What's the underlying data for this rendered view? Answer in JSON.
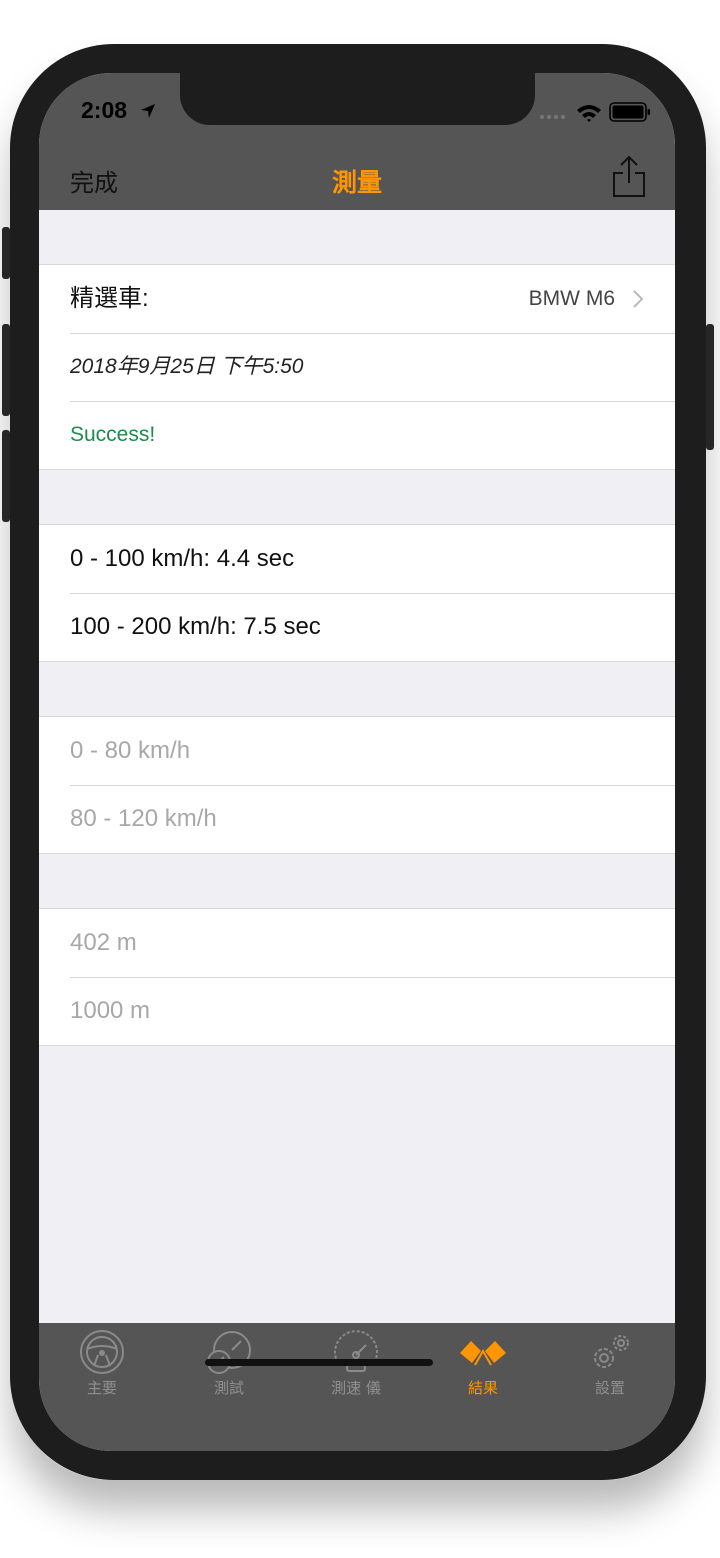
{
  "status_bar": {
    "time": "2:08"
  },
  "nav": {
    "left_label": "完成",
    "title": "測量"
  },
  "car_section": {
    "car_label": "精選車:",
    "car_value": "BMW M6",
    "date": "2018年9月25日 下午5:50",
    "status": "Success!"
  },
  "speed_results": [
    {
      "label": "0 - 100 km/h: 4.4 sec"
    },
    {
      "label": "100 - 200 km/h: 7.5 sec"
    }
  ],
  "passing_results": [
    {
      "label": "0 - 80 km/h"
    },
    {
      "label": "80 - 120 km/h"
    }
  ],
  "distance_results": [
    {
      "label": "402 m"
    },
    {
      "label": "1000 m"
    }
  ],
  "tabs": [
    {
      "label": "主要",
      "icon": "steering-wheel-icon"
    },
    {
      "label": "測試",
      "icon": "gauges-icon"
    },
    {
      "label": "測速 儀",
      "icon": "speedometer-icon"
    },
    {
      "label": "結果",
      "icon": "racing-flags-icon",
      "active": true
    },
    {
      "label": "設置",
      "icon": "gears-icon"
    }
  ],
  "colors": {
    "accent": "#ff9500",
    "success": "#1d8c4a",
    "bar": "#555555"
  }
}
